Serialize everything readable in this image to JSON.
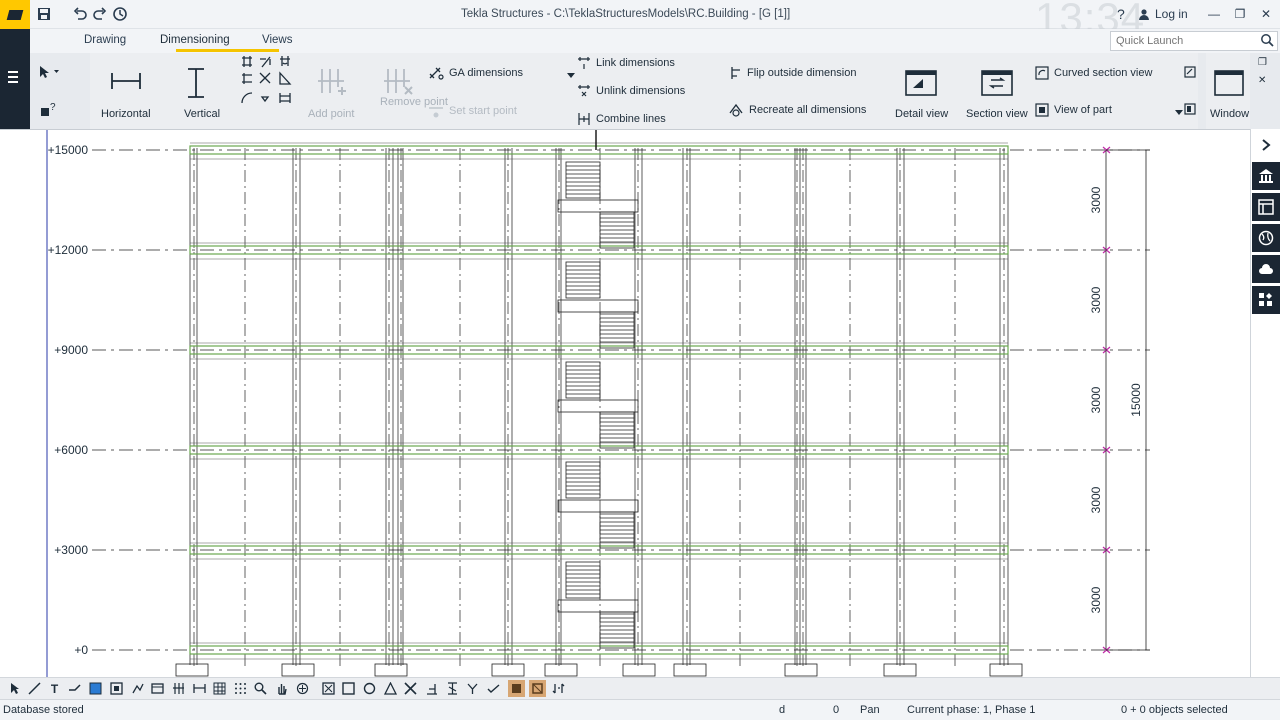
{
  "window": {
    "title": "Tekla Structures - C:\\TeklaStructuresModels\\RC.Building - [G   [1]]",
    "clock": "13:34",
    "help": "?",
    "login": "Log in",
    "minimize": "—",
    "restore": "❐",
    "close": "✕"
  },
  "ribbon": {
    "tabs": [
      "Drawing",
      "Dimensioning",
      "Views"
    ],
    "active_tab": "Dimensioning",
    "quick_launch_placeholder": "Quick Launch",
    "dimensioning": {
      "horizontal": "Horizontal",
      "vertical": "Vertical",
      "add_point": "Add point",
      "remove_point": "Remove point",
      "ga_dimensions": "GA dimensions",
      "set_start_point": "Set start point",
      "link_dimensions": "Link dimensions",
      "unlink_dimensions": "Unlink dimensions",
      "combine_lines": "Combine lines",
      "flip_outside_dimension": "Flip outside dimension",
      "recreate_all_dimensions": "Recreate all dimensions"
    },
    "views": {
      "detail_view": "Detail view",
      "section_view": "Section view",
      "curved_section_view": "Curved section view",
      "view_of_part": "View of part",
      "window": "Window"
    }
  },
  "drawing": {
    "levels": [
      "+15000",
      "+12000",
      "+9000",
      "+6000",
      "+3000",
      "+0"
    ],
    "storey_dimensions": [
      "3000",
      "3000",
      "3000",
      "3000",
      "3000"
    ],
    "total_dimension": "15000"
  },
  "side_panel": {
    "icons": [
      "chevron-right-icon",
      "library-icon",
      "properties-icon",
      "globe-icon",
      "cloud-icon",
      "apps-icon"
    ]
  },
  "status": {
    "message": "Database stored",
    "field_d": "d",
    "field_zero": "0",
    "mode": "Pan",
    "phase": "Current phase: 1, Phase 1",
    "selection": "0 + 0 objects selected"
  },
  "colors": {
    "accent": "#ffc800",
    "dark": "#1b2633",
    "beam_green": "#6aa84f",
    "dimension_magenta": "#c02aa9"
  }
}
